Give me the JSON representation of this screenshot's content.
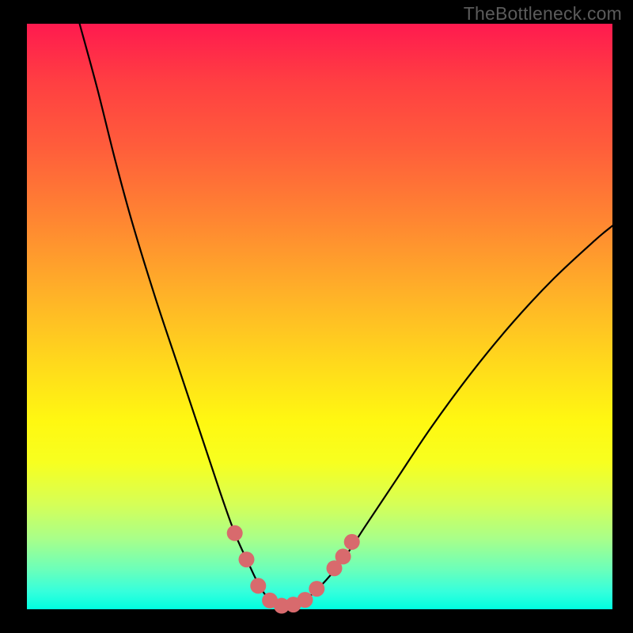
{
  "watermark": "TheBottleneck.com",
  "colors": {
    "curve_stroke": "#000000",
    "marker_fill": "#d86a6d",
    "background_black": "#000000"
  },
  "chart_data": {
    "type": "line",
    "title": "",
    "xlabel": "",
    "ylabel": "",
    "xlim": [
      0,
      100
    ],
    "ylim": [
      0,
      100
    ],
    "grid": false,
    "legend": false,
    "note": "Axes are implied (no tick labels rendered). x/y values are estimated from pixel positions as percentages of the plot area; y=0 at bottom (green), y=100 at top (red).",
    "series": [
      {
        "name": "bottleneck-curve",
        "x": [
          9,
          12,
          15,
          18,
          22,
          26,
          30,
          33,
          35.5,
          38,
          40,
          42,
          44.5,
          47,
          50,
          54,
          58,
          63,
          69,
          76,
          83,
          90,
          97,
          100
        ],
        "y": [
          100,
          89,
          77,
          66,
          53,
          41,
          29,
          20,
          13,
          7.5,
          3.5,
          1.2,
          0.5,
          1.3,
          3.8,
          8.5,
          14.5,
          22,
          31,
          40.5,
          49,
          56.5,
          63,
          65.5
        ]
      }
    ],
    "markers": {
      "name": "highlighted-segment",
      "points": [
        {
          "x": 35.5,
          "y": 13
        },
        {
          "x": 37.5,
          "y": 8.5
        },
        {
          "x": 39.5,
          "y": 4
        },
        {
          "x": 41.5,
          "y": 1.5
        },
        {
          "x": 43.5,
          "y": 0.6
        },
        {
          "x": 45.5,
          "y": 0.8
        },
        {
          "x": 47.5,
          "y": 1.6
        },
        {
          "x": 49.5,
          "y": 3.5
        },
        {
          "x": 52.5,
          "y": 7
        },
        {
          "x": 54,
          "y": 9
        },
        {
          "x": 55.5,
          "y": 11.5
        }
      ]
    }
  }
}
